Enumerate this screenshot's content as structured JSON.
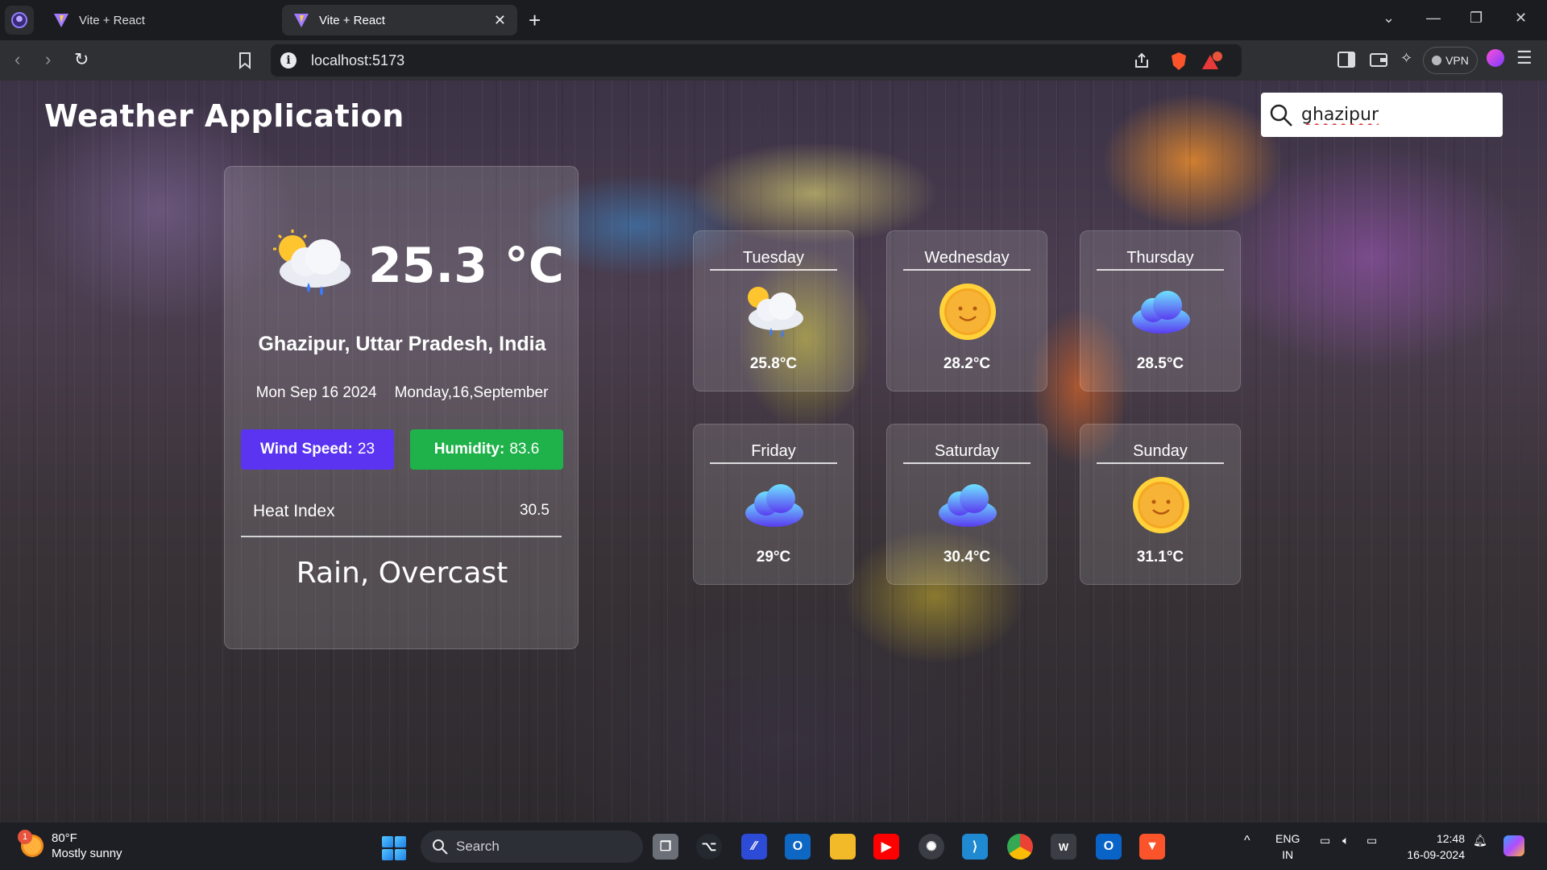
{
  "browser": {
    "tabs": [
      {
        "label": "Vite + React",
        "active": false
      },
      {
        "label": "Vite + React",
        "active": true
      }
    ],
    "url": "localhost:5173",
    "vpn_label": "VPN",
    "notification_count": "1"
  },
  "app": {
    "title": "Weather Application",
    "search": {
      "value": "ghazipur"
    }
  },
  "current": {
    "icon": "sun-cloud-rain-icon",
    "temperature": "25.3 °C",
    "location": "Ghazipur, Uttar Pradesh, India",
    "date_short": "Mon Sep 16 2024",
    "date_long": "Monday,16,September",
    "wind_label": "Wind Speed:",
    "wind_value": "23",
    "humidity_label": "Humidity:",
    "humidity_value": "83.6",
    "heat_index_label": "Heat Index",
    "heat_index_value": "30.5",
    "condition": "Rain, Overcast"
  },
  "forecast": [
    {
      "day": "Tuesday",
      "temp": "25.8°C",
      "icon": "sun-cloud-rain-icon"
    },
    {
      "day": "Wednesday",
      "temp": "28.2°C",
      "icon": "sun-icon"
    },
    {
      "day": "Thursday",
      "temp": "28.5°C",
      "icon": "cloud-icon"
    },
    {
      "day": "Friday",
      "temp": "29°C",
      "icon": "cloud-icon"
    },
    {
      "day": "Saturday",
      "temp": "30.4°C",
      "icon": "cloud-icon"
    },
    {
      "day": "Sunday",
      "temp": "31.1°C",
      "icon": "sun-icon"
    }
  ],
  "taskbar": {
    "weather_temp": "80°F",
    "weather_desc": "Mostly sunny",
    "weather_badge": "1",
    "search_label": "Search",
    "lang_top": "ENG",
    "lang_bottom": "IN",
    "time": "12:48",
    "date": "16-09-2024"
  },
  "colors": {
    "wind_pill": "#5a34f0",
    "humidity_pill": "#1fb24a"
  }
}
